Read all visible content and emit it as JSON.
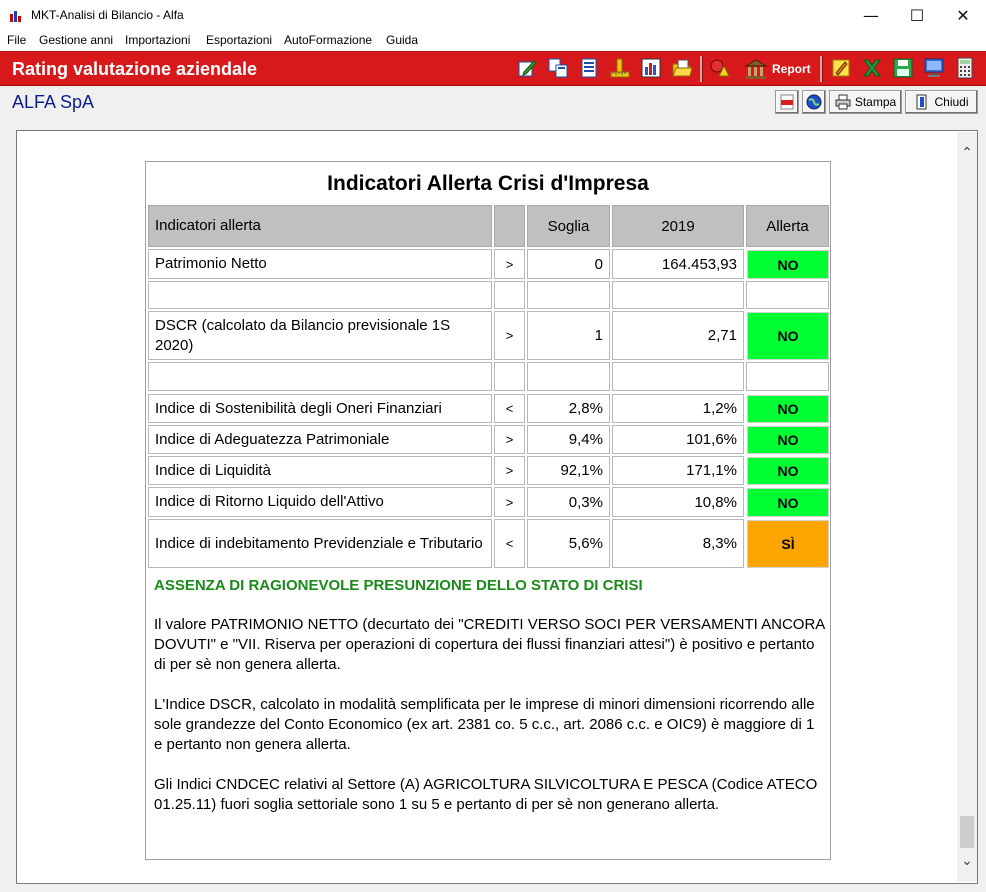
{
  "window": {
    "title": "MKT-Analisi di Bilancio  -  Alfa",
    "minimize_glyph": "—",
    "maximize_glyph": "☐",
    "close_glyph": "✕"
  },
  "menu": [
    "File",
    "Gestione anni",
    "Importazioni",
    "Esportazioni",
    "AutoFormazione",
    "Guida"
  ],
  "toolbar": {
    "heading": "Rating valutazione aziendale",
    "report_label": "Report",
    "icons": [
      "edit-icon",
      "copy-icon",
      "list-icon",
      "ruler-icon",
      "bar-chart-icon",
      "open-folder-icon",
      "shapes-icon",
      "bank-icon",
      "pencil-icon",
      "excel-icon",
      "save-icon",
      "monitor-icon",
      "calculator-icon"
    ]
  },
  "subbar": {
    "company": "ALFA SpA",
    "print_label": "Stampa",
    "close_label": "Chiudi"
  },
  "colors": {
    "accent_red": "#d8191c",
    "alert_ok": "#00ff33",
    "alert_warn": "#ffa500",
    "verdict_green": "#1a8a1a"
  },
  "report": {
    "title": "Indicatori Allerta Crisi d'Impresa",
    "headers": {
      "indicator": "Indicatori allerta",
      "cmp": "",
      "threshold": "Soglia",
      "year": "2019",
      "alert": "Allerta"
    },
    "rows": [
      {
        "label": "Patrimonio Netto",
        "cmp": ">",
        "threshold": "0",
        "value": "164.453,93",
        "alert": "NO"
      },
      {
        "label": "",
        "cmp": "",
        "threshold": "",
        "value": "",
        "alert": ""
      },
      {
        "label": "DSCR (calcolato da Bilancio previsionale 1S 2020)",
        "cmp": ">",
        "threshold": "1",
        "value": "2,71",
        "alert": "NO"
      },
      {
        "label": "",
        "cmp": "",
        "threshold": "",
        "value": "",
        "alert": ""
      },
      {
        "label": "Indice di Sostenibilità degli Oneri Finanziari",
        "cmp": "<",
        "threshold": "2,8%",
        "value": "1,2%",
        "alert": "NO"
      },
      {
        "label": "Indice di Adeguatezza Patrimoniale",
        "cmp": ">",
        "threshold": "9,4%",
        "value": "101,6%",
        "alert": "NO"
      },
      {
        "label": "Indice di Liquidità",
        "cmp": ">",
        "threshold": "92,1%",
        "value": "171,1%",
        "alert": "NO"
      },
      {
        "label": "Indice di Ritorno Liquido dell'Attivo",
        "cmp": ">",
        "threshold": "0,3%",
        "value": "10,8%",
        "alert": "NO"
      },
      {
        "label": "Indice di indebitamento Previdenziale e Tributario",
        "cmp": "<",
        "threshold": "5,6%",
        "value": "8,3%",
        "alert": "SÌ"
      }
    ],
    "verdict": "ASSENZA DI RAGIONEVOLE PRESUNZIONE DELLO STATO DI CRISI",
    "paragraphs": [
      "Il valore PATRIMONIO NETTO (decurtato dei \"CREDITI VERSO SOCI PER VERSAMENTI ANCORA DOVUTI\" e \"VII. Riserva per operazioni di copertura dei flussi finanziari attesi\") è positivo e pertanto di per sè non genera allerta.",
      "L'Indice DSCR, calcolato in modalità semplificata per le imprese di minori dimensioni ricorrendo alle sole grandezze del Conto Economico (ex art. 2381 co. 5 c.c., art. 2086 c.c. e OIC9) è maggiore di 1 e pertanto non genera allerta.",
      "Gli Indici CNDCEC relativi al Settore (A) AGRICOLTURA SILVICOLTURA E PESCA (Codice ATECO 01.25.11) fuori soglia settoriale sono 1 su 5 e pertanto di per sè non generano allerta."
    ]
  }
}
